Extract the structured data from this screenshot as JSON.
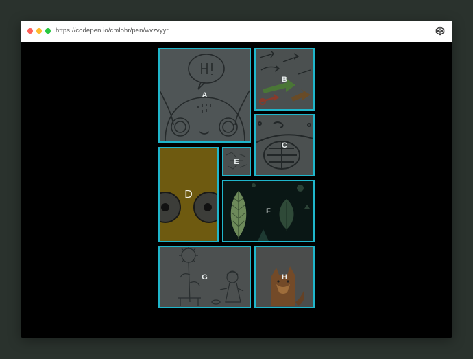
{
  "browser": {
    "url": "https://codepen.io/cmlohr/pen/wvzvyyr",
    "codepen_icon": "codepen-cube-icon"
  },
  "grid": {
    "border_color": "#1fb6cb",
    "panels": [
      {
        "id": "a",
        "label": "A"
      },
      {
        "id": "b",
        "label": "B"
      },
      {
        "id": "c",
        "label": "C"
      },
      {
        "id": "d",
        "label": "D"
      },
      {
        "id": "e",
        "label": "E"
      },
      {
        "id": "f",
        "label": "F"
      },
      {
        "id": "g",
        "label": "G"
      },
      {
        "id": "h",
        "label": "H"
      }
    ]
  }
}
